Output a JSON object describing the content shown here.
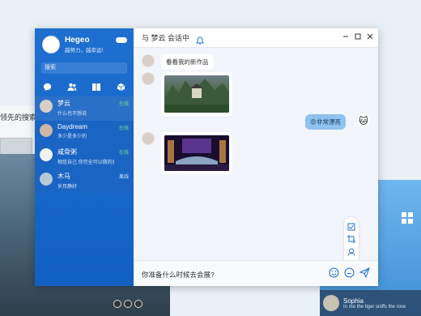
{
  "background": {
    "left_title": "领先的搜索引",
    "right_user": {
      "name": "Sophia",
      "message": "In me the tiger sniffs the rose"
    }
  },
  "profile": {
    "name": "Hegeo",
    "motto": "越努力，越幸运!"
  },
  "search": {
    "placeholder": "搜索"
  },
  "nav": [
    "chat-icon",
    "contacts-icon",
    "books-icon",
    "cube-icon"
  ],
  "contacts": [
    {
      "name": "梦云",
      "message": "什么也不想说",
      "status": "在线",
      "online": true
    },
    {
      "name": "Daydream",
      "message": "多少是多少的",
      "status": "在线",
      "online": true
    },
    {
      "name": "咸骨粥",
      "message": "相信自己 你完全可以做的更好的",
      "status": "在线",
      "online": true
    },
    {
      "name": "木马",
      "message": "岁月静好",
      "status": "离线",
      "online": false
    }
  ],
  "chat": {
    "title": "与 梦云 会话中",
    "messages": [
      {
        "from": "them",
        "text": "看看我的新作品"
      },
      {
        "from": "them",
        "image": "mountain-temple-image"
      },
      {
        "from": "me",
        "text": "😍非常漂亮"
      },
      {
        "from": "them",
        "image": "neon-car-image"
      }
    ],
    "input_text": "你准备什么时候去会展?"
  },
  "colors": {
    "sidebar": "#1260c4",
    "my_bubble": "#8ec2f0",
    "online": "#7be07b"
  }
}
